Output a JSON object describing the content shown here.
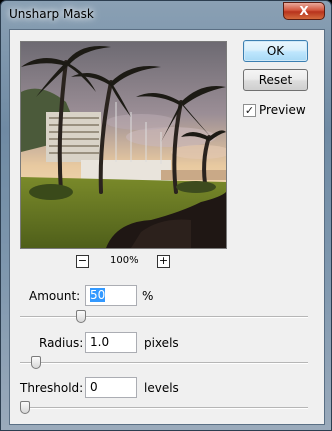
{
  "window": {
    "title": "Unsharp Mask",
    "close_glyph": "X"
  },
  "preview": {
    "zoom_out": "−",
    "zoom_in": "+",
    "zoom_level": "100%"
  },
  "buttons": {
    "ok": "OK",
    "reset": "Reset"
  },
  "preview_toggle": {
    "label": "Preview",
    "checked": true
  },
  "amount": {
    "label": "Amount:",
    "value": "50",
    "unit": "%",
    "slider_fraction": 0.2
  },
  "radius": {
    "label": "Radius:",
    "value": "1.0",
    "unit": "pixels",
    "slider_fraction": 0.04
  },
  "threshold": {
    "label": "Threshold:",
    "value": "0",
    "unit": "levels",
    "slider_fraction": 0.0
  }
}
